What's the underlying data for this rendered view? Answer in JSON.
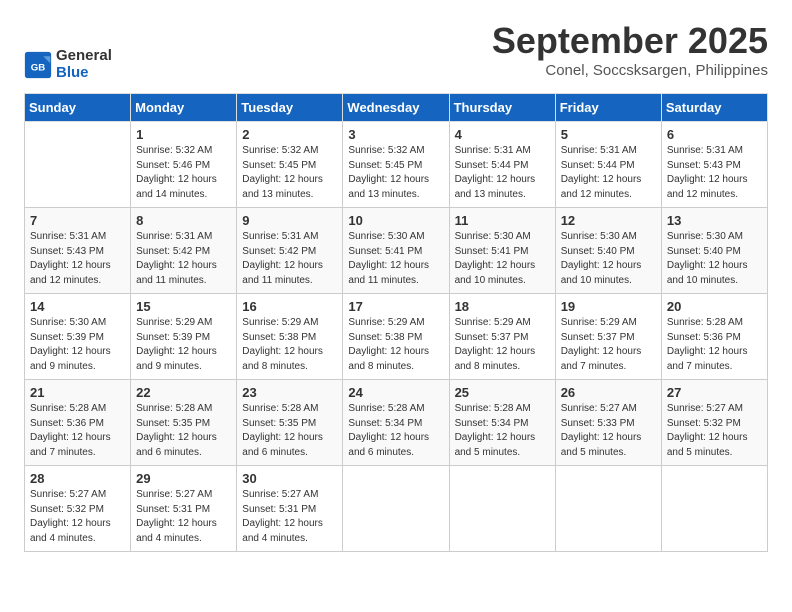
{
  "header": {
    "logo_line1": "General",
    "logo_line2": "Blue",
    "title": "September 2025",
    "subtitle": "Conel, Soccsksargen, Philippines"
  },
  "calendar": {
    "days_of_week": [
      "Sunday",
      "Monday",
      "Tuesday",
      "Wednesday",
      "Thursday",
      "Friday",
      "Saturday"
    ],
    "weeks": [
      [
        {
          "day": "",
          "info": ""
        },
        {
          "day": "1",
          "info": "Sunrise: 5:32 AM\nSunset: 5:46 PM\nDaylight: 12 hours\nand 14 minutes."
        },
        {
          "day": "2",
          "info": "Sunrise: 5:32 AM\nSunset: 5:45 PM\nDaylight: 12 hours\nand 13 minutes."
        },
        {
          "day": "3",
          "info": "Sunrise: 5:32 AM\nSunset: 5:45 PM\nDaylight: 12 hours\nand 13 minutes."
        },
        {
          "day": "4",
          "info": "Sunrise: 5:31 AM\nSunset: 5:44 PM\nDaylight: 12 hours\nand 13 minutes."
        },
        {
          "day": "5",
          "info": "Sunrise: 5:31 AM\nSunset: 5:44 PM\nDaylight: 12 hours\nand 12 minutes."
        },
        {
          "day": "6",
          "info": "Sunrise: 5:31 AM\nSunset: 5:43 PM\nDaylight: 12 hours\nand 12 minutes."
        }
      ],
      [
        {
          "day": "7",
          "info": "Sunrise: 5:31 AM\nSunset: 5:43 PM\nDaylight: 12 hours\nand 12 minutes."
        },
        {
          "day": "8",
          "info": "Sunrise: 5:31 AM\nSunset: 5:42 PM\nDaylight: 12 hours\nand 11 minutes."
        },
        {
          "day": "9",
          "info": "Sunrise: 5:31 AM\nSunset: 5:42 PM\nDaylight: 12 hours\nand 11 minutes."
        },
        {
          "day": "10",
          "info": "Sunrise: 5:30 AM\nSunset: 5:41 PM\nDaylight: 12 hours\nand 11 minutes."
        },
        {
          "day": "11",
          "info": "Sunrise: 5:30 AM\nSunset: 5:41 PM\nDaylight: 12 hours\nand 10 minutes."
        },
        {
          "day": "12",
          "info": "Sunrise: 5:30 AM\nSunset: 5:40 PM\nDaylight: 12 hours\nand 10 minutes."
        },
        {
          "day": "13",
          "info": "Sunrise: 5:30 AM\nSunset: 5:40 PM\nDaylight: 12 hours\nand 10 minutes."
        }
      ],
      [
        {
          "day": "14",
          "info": "Sunrise: 5:30 AM\nSunset: 5:39 PM\nDaylight: 12 hours\nand 9 minutes."
        },
        {
          "day": "15",
          "info": "Sunrise: 5:29 AM\nSunset: 5:39 PM\nDaylight: 12 hours\nand 9 minutes."
        },
        {
          "day": "16",
          "info": "Sunrise: 5:29 AM\nSunset: 5:38 PM\nDaylight: 12 hours\nand 8 minutes."
        },
        {
          "day": "17",
          "info": "Sunrise: 5:29 AM\nSunset: 5:38 PM\nDaylight: 12 hours\nand 8 minutes."
        },
        {
          "day": "18",
          "info": "Sunrise: 5:29 AM\nSunset: 5:37 PM\nDaylight: 12 hours\nand 8 minutes."
        },
        {
          "day": "19",
          "info": "Sunrise: 5:29 AM\nSunset: 5:37 PM\nDaylight: 12 hours\nand 7 minutes."
        },
        {
          "day": "20",
          "info": "Sunrise: 5:28 AM\nSunset: 5:36 PM\nDaylight: 12 hours\nand 7 minutes."
        }
      ],
      [
        {
          "day": "21",
          "info": "Sunrise: 5:28 AM\nSunset: 5:36 PM\nDaylight: 12 hours\nand 7 minutes."
        },
        {
          "day": "22",
          "info": "Sunrise: 5:28 AM\nSunset: 5:35 PM\nDaylight: 12 hours\nand 6 minutes."
        },
        {
          "day": "23",
          "info": "Sunrise: 5:28 AM\nSunset: 5:35 PM\nDaylight: 12 hours\nand 6 minutes."
        },
        {
          "day": "24",
          "info": "Sunrise: 5:28 AM\nSunset: 5:34 PM\nDaylight: 12 hours\nand 6 minutes."
        },
        {
          "day": "25",
          "info": "Sunrise: 5:28 AM\nSunset: 5:34 PM\nDaylight: 12 hours\nand 5 minutes."
        },
        {
          "day": "26",
          "info": "Sunrise: 5:27 AM\nSunset: 5:33 PM\nDaylight: 12 hours\nand 5 minutes."
        },
        {
          "day": "27",
          "info": "Sunrise: 5:27 AM\nSunset: 5:32 PM\nDaylight: 12 hours\nand 5 minutes."
        }
      ],
      [
        {
          "day": "28",
          "info": "Sunrise: 5:27 AM\nSunset: 5:32 PM\nDaylight: 12 hours\nand 4 minutes."
        },
        {
          "day": "29",
          "info": "Sunrise: 5:27 AM\nSunset: 5:31 PM\nDaylight: 12 hours\nand 4 minutes."
        },
        {
          "day": "30",
          "info": "Sunrise: 5:27 AM\nSunset: 5:31 PM\nDaylight: 12 hours\nand 4 minutes."
        },
        {
          "day": "",
          "info": ""
        },
        {
          "day": "",
          "info": ""
        },
        {
          "day": "",
          "info": ""
        },
        {
          "day": "",
          "info": ""
        }
      ]
    ]
  }
}
